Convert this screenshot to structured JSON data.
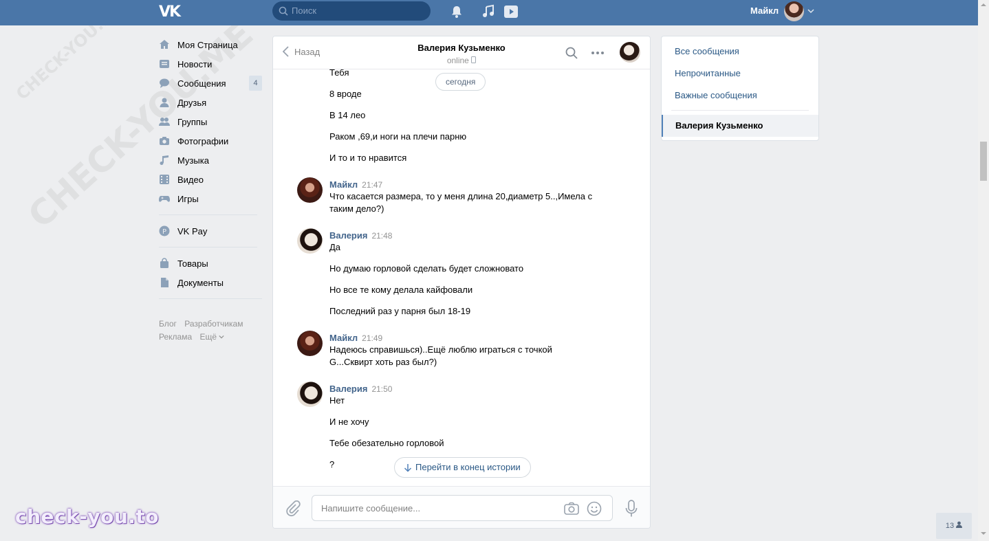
{
  "header": {
    "logo": "VK",
    "search_placeholder": "Поиск",
    "user_name": "Майкл"
  },
  "nav": {
    "items": [
      {
        "label": "Моя Страница",
        "icon": "home-icon"
      },
      {
        "label": "Новости",
        "icon": "news-icon"
      },
      {
        "label": "Сообщения",
        "icon": "messages-icon",
        "badge": "4"
      },
      {
        "label": "Друзья",
        "icon": "friends-icon"
      },
      {
        "label": "Группы",
        "icon": "groups-icon"
      },
      {
        "label": "Фотографии",
        "icon": "camera-icon"
      },
      {
        "label": "Музыка",
        "icon": "music-icon"
      },
      {
        "label": "Видео",
        "icon": "video-icon"
      },
      {
        "label": "Игры",
        "icon": "gamepad-icon"
      }
    ],
    "vkpay": "VK Pay",
    "goods": "Товары",
    "docs": "Документы",
    "footer": {
      "blog": "Блог",
      "dev": "Разработчикам",
      "ads": "Реклама",
      "more": "Ещё"
    }
  },
  "chat": {
    "back": "Назад",
    "peer_name": "Валерия Кузьменко",
    "peer_status": "online",
    "date_pill": "сегодня",
    "top_lines": [
      "Тебя",
      "8 вроде",
      "В 14 лео",
      "Раком ,69,и ноги на плечи парню",
      "И то и то нравится"
    ],
    "groups": [
      {
        "author": "Майкл",
        "time": "21:47",
        "lines": [
          "Что касается размера, то у меня длина 20,диаметр 5..,Имела с таким дело?)"
        ]
      },
      {
        "author": "Валерия",
        "time": "21:48",
        "lines": [
          "Да",
          "Но думаю горловой сделать будет сложновато",
          "Но все те кому делала кайфовали",
          "Последний раз у парня был 18-19"
        ]
      },
      {
        "author": "Майкл",
        "time": "21:49",
        "lines": [
          "Надеюсь справишься)..Ещё люблю играться с точкой G...Сквирт хоть раз был?)"
        ]
      },
      {
        "author": "Валерия",
        "time": "21:50",
        "lines": [
          "Нет",
          "И не хочу",
          "Тебе обезательно горловой",
          "?"
        ]
      }
    ],
    "jump_label": "Перейти в конец истории",
    "compose_placeholder": "Напишите сообщение..."
  },
  "right": {
    "all": "Все сообщения",
    "unread": "Непрочитанные",
    "important": "Важные сообщения",
    "active": "Валерия Кузьменко"
  },
  "watermark": "check-you.to",
  "bg_watermark": "CHECK-YOU.ME",
  "online_counter": "13",
  "colors": {
    "header": "#4a76a8",
    "link": "#2a5885",
    "author": "#42648b"
  }
}
